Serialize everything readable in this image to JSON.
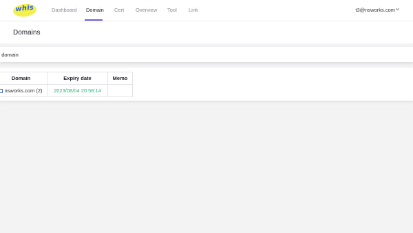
{
  "app": {
    "logo_text": "whis"
  },
  "nav": {
    "items": [
      {
        "label": "Dashboard"
      },
      {
        "label": "Domain"
      },
      {
        "label": "Cert"
      },
      {
        "label": "Overview"
      },
      {
        "label": "Tool"
      },
      {
        "label": "Link"
      }
    ],
    "active": "Domain"
  },
  "user": {
    "email": "t3@nsworks.com"
  },
  "page": {
    "title": "Domains"
  },
  "add_domain": {
    "label": "d domain"
  },
  "table": {
    "headers": {
      "domain": "Domain",
      "expiry": "Expiry date",
      "memo": "Memo"
    },
    "rows": [
      {
        "domain": "nsworks.com (2)",
        "expiry": "2023/08/04 20:58:14",
        "memo": ""
      }
    ]
  },
  "colors": {
    "accent": "#6e5ee6",
    "expiry_green": "#2bb57a",
    "logo_yellow": "#f2f04c",
    "logo_blue": "#2f5fe0"
  }
}
